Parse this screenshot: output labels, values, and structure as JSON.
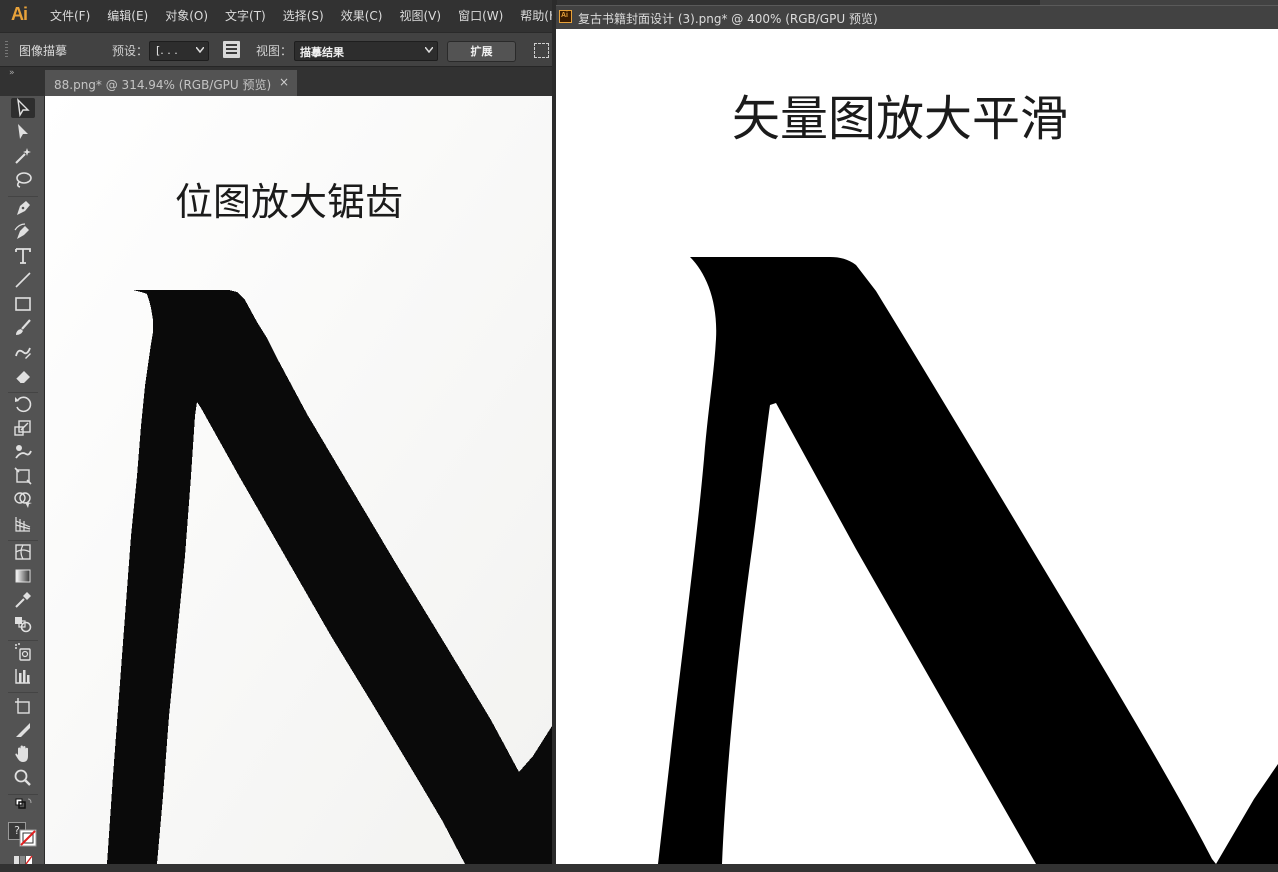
{
  "app": {
    "logo": "Ai",
    "accent": "#e8a23a"
  },
  "menu": [
    "文件(F)",
    "编辑(E)",
    "对象(O)",
    "文字(T)",
    "选择(S)",
    "效果(C)",
    "视图(V)",
    "窗口(W)",
    "帮助(H"
  ],
  "control_bar": {
    "title": "图像描摹",
    "preset_label": "预设：",
    "preset_value": "[. . .",
    "view_label": "视图：",
    "view_value": "描摹结果",
    "expand_button": "扩展"
  },
  "left_document": {
    "tab_title": "88.png* @ 314.94% (RGB/GPU 预览)",
    "close_glyph": "×",
    "caption": "位图放大锯齿"
  },
  "right_document": {
    "window_icon": "Ai",
    "title": "复古书籍封面设计 (3).png* @ 400% (RGB/GPU 预览)",
    "caption": "矢量图放大平滑"
  },
  "toolbar": {
    "collapse_glyph": "»",
    "tools": [
      "selection-tool-icon",
      "direct-selection-tool-icon",
      "magic-wand-tool-icon",
      "lasso-tool-icon",
      "pen-tool-icon",
      "curvature-tool-icon",
      "type-tool-icon",
      "line-segment-tool-icon",
      "rectangle-tool-icon",
      "paintbrush-tool-icon",
      "shaper-tool-icon",
      "eraser-tool-icon",
      "rotate-tool-icon",
      "scale-tool-icon",
      "puppet-warp-tool-icon",
      "free-transform-tool-icon",
      "shape-builder-tool-icon",
      "perspective-grid-tool-icon",
      "mesh-tool-icon",
      "gradient-tool-icon",
      "eyedropper-tool-icon",
      "blend-tool-icon",
      "symbol-sprayer-tool-icon",
      "column-graph-tool-icon",
      "artboard-tool-icon",
      "slice-tool-icon",
      "hand-tool-icon",
      "zoom-tool-icon"
    ],
    "fill_stroke_help": "?"
  }
}
